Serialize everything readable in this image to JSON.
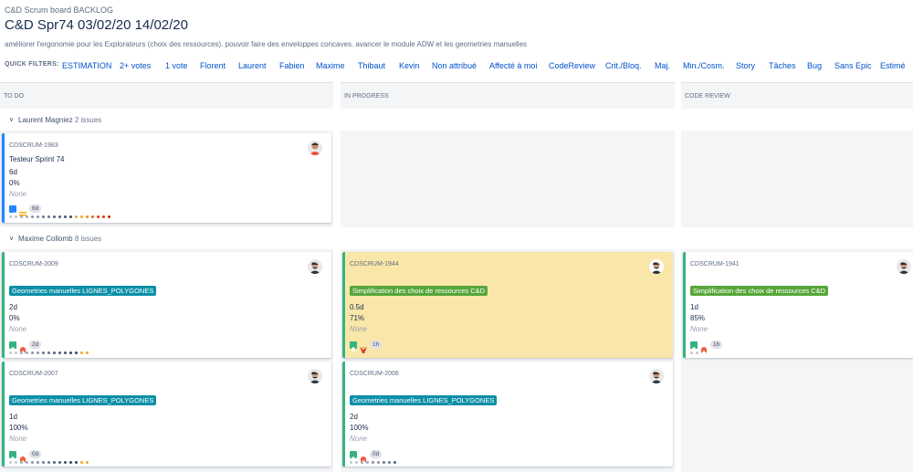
{
  "board": {
    "breadcrumb": "C&D Scrum board BACKLOG",
    "title": "C&D Spr74 03/02/20 14/02/20",
    "goal": "améliorer l'ergonomie pour les Explorateurs (choix des ressources). pouvoir faire des enveloppes concaves. avancer le module ADW et les geometries manuelles"
  },
  "quick_filters": {
    "label": "QUICK FILTERS:",
    "items": [
      "ESTIMATION",
      "2+ votes",
      "1 vote",
      "Florent",
      "Laurent",
      "Fabien",
      "Maxime",
      "Thibaut",
      "Kevin",
      "Non attribué",
      "Affecté à moi",
      "CodeReview",
      "Crit./Bloq.",
      "Maj.",
      "Min./Cosm.",
      "Story",
      "Tâches",
      "Bug",
      "Sans Epic",
      "Estimé"
    ]
  },
  "columns": [
    "TO DO",
    "IN PROGRESS",
    "CODE REVIEW"
  ],
  "swimlanes": [
    {
      "name": "Laurent Magniez",
      "count": "2 issues"
    },
    {
      "name": "Maxime Collomb",
      "count": "8 issues"
    }
  ],
  "cards": [
    {
      "key": "CDSCRUM-1983",
      "summary": "Testeur Sprint 74",
      "epic": "",
      "estimate": "6d",
      "progress": "0%",
      "label": "None",
      "time": "6d",
      "type": "task-icon",
      "priority": "medium-priority-icon"
    },
    {
      "key": "CDSCRUM-2009",
      "summary": "",
      "epic": "Geometries manuelles LIGNES_POLYGONES",
      "estimate": "2d",
      "progress": "0%",
      "label": "None",
      "time": "2d",
      "type": "story-icon",
      "priority": "high-priority-icon"
    },
    {
      "key": "CDSCRUM-1944",
      "summary": "",
      "epic": "Simplification des choix de ressources C&D",
      "estimate": "0.5d",
      "progress": "71%",
      "label": "None",
      "time": "1h",
      "type": "story-icon",
      "priority": "highest-priority-icon"
    },
    {
      "key": "CDSCRUM-1941",
      "summary": "",
      "epic": "Simplification des choix de ressources C&D",
      "estimate": "1d",
      "progress": "85%",
      "label": "None",
      "time": "1h",
      "type": "story-icon",
      "priority": "high-priority-icon"
    },
    {
      "key": "CDSCRUM-2007",
      "summary": "",
      "epic": "Geometries manuelles LIGNES_POLYGONES",
      "estimate": "1d",
      "progress": "100%",
      "label": "None",
      "time": "0d",
      "type": "story-icon",
      "priority": "high-priority-icon"
    },
    {
      "key": "CDSCRUM-2006",
      "summary": "",
      "epic": "Geometries manuelles LIGNES_POLYGONES",
      "estimate": "2d",
      "progress": "100%",
      "label": "None",
      "time": "0d",
      "type": "story-icon",
      "priority": "high-priority-icon"
    }
  ],
  "colors": {
    "story": "#36b37e",
    "task": "#2684ff",
    "epic_blue": "#0c8fa8",
    "epic_green": "#56a63a",
    "in_progress_card": "#f9e7a9",
    "link": "#0052cc"
  }
}
